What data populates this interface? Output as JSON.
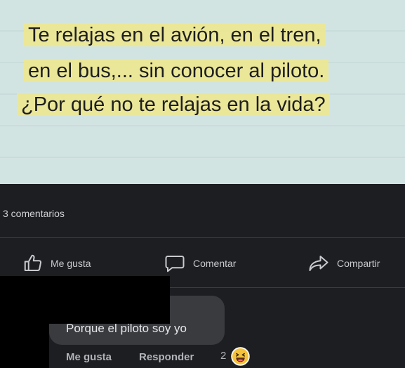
{
  "note": {
    "lines": [
      "Te relajas en el avión, en el tren,",
      "en el bus,... sin conocer al piloto.",
      "¿Por qué no te relajas en la vida?"
    ]
  },
  "post": {
    "comments_count": "3 comentarios",
    "actions": {
      "like": "Me gusta",
      "comment": "Comentar",
      "share": "Compartir"
    }
  },
  "comment": {
    "text": "Porque el piloto soy yo",
    "like": "Me gusta",
    "reply": "Responder",
    "reaction_count": "2",
    "reaction_icon": "laughing-emoji-icon"
  },
  "colors": {
    "highlight": "#f0e88c",
    "background": "#1c1e22",
    "bubble": "#3a3b3f"
  }
}
